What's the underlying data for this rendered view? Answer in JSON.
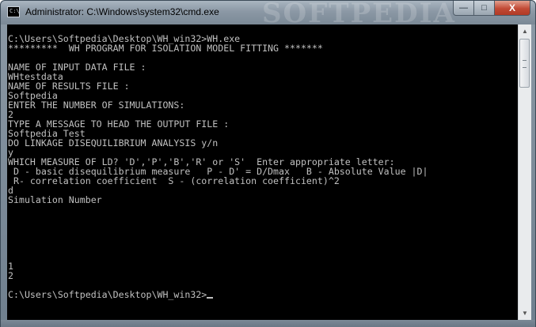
{
  "window": {
    "title": "Administrator: C:\\Windows\\system32\\cmd.exe",
    "watermark": "SOFTPEDIA",
    "app_icon_text": "C:\\"
  },
  "caption_buttons": {
    "minimize": "—",
    "maximize": "□",
    "close": "X"
  },
  "console": {
    "lines": [
      "C:\\Users\\Softpedia\\Desktop\\WH_win32>WH.exe",
      "*********  WH PROGRAM FOR ISOLATION MODEL FITTING *******",
      "",
      "NAME OF INPUT DATA FILE :",
      "WHtestdata",
      "NAME OF RESULTS FILE :",
      "Softpedia",
      "ENTER THE NUMBER OF SIMULATIONS:",
      "2",
      "TYPE A MESSAGE TO HEAD THE OUTPUT FILE :",
      "Softpedia Test",
      "DO LINKAGE DISEQUILIBRIUM ANALYSIS y/n",
      "y",
      "WHICH MEASURE OF LD? 'D','P','B','R' or 'S'  Enter appropriate letter:",
      " D - basic disequilibrium measure   P - D' = D/Dmax   B - Absolute Value |D|",
      " R- correlation coefficient  S - (correlation coefficient)^2",
      "d",
      "Simulation Number",
      "",
      "",
      "",
      "",
      "",
      "",
      "1",
      "2",
      "",
      "C:\\Users\\Softpedia\\Desktop\\WH_win32>"
    ]
  },
  "colors": {
    "console_bg": "#000000",
    "console_text": "#c0c0c0",
    "close_button": "#c24a35"
  }
}
